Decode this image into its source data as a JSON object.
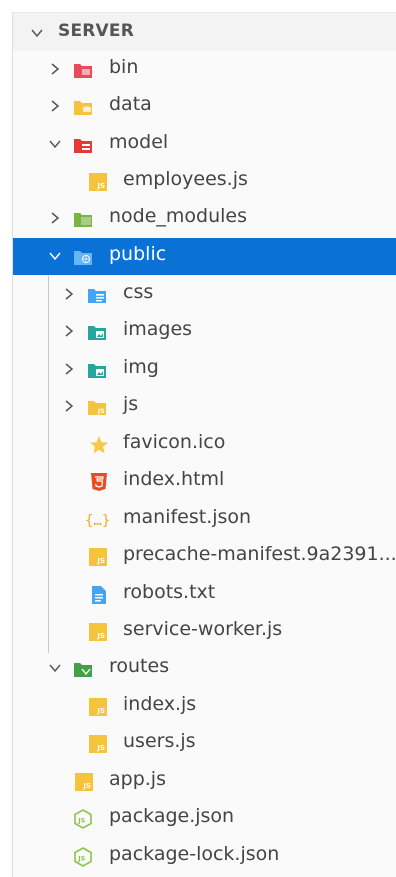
{
  "explorer": {
    "section_title": "SERVER",
    "items": [
      {
        "label": "bin",
        "kind": "folder",
        "expanded": false,
        "icon": "bin-folder-icon",
        "color": "#e84c5c"
      },
      {
        "label": "data",
        "kind": "folder",
        "expanded": false,
        "icon": "data-folder-icon",
        "color": "#f5c33c"
      },
      {
        "label": "model",
        "kind": "folder",
        "expanded": true,
        "icon": "model-folder-icon",
        "color": "#e53935"
      },
      {
        "label": "employees.js",
        "kind": "file",
        "icon": "javascript-file-icon",
        "color": "#f5c33c"
      },
      {
        "label": "node_modules",
        "kind": "folder",
        "expanded": false,
        "icon": "node-modules-folder-icon",
        "color": "#7cb342"
      },
      {
        "label": "public",
        "kind": "folder",
        "expanded": true,
        "selected": true,
        "icon": "public-folder-icon",
        "color": "#42a5f5"
      },
      {
        "label": "css",
        "kind": "folder",
        "expanded": false,
        "icon": "css-folder-icon",
        "color": "#42a5f5"
      },
      {
        "label": "images",
        "kind": "folder",
        "expanded": false,
        "icon": "images-folder-icon",
        "color": "#26a69a"
      },
      {
        "label": "img",
        "kind": "folder",
        "expanded": false,
        "icon": "img-folder-icon",
        "color": "#26a69a"
      },
      {
        "label": "js",
        "kind": "folder",
        "expanded": false,
        "icon": "js-folder-icon",
        "color": "#f5c33c"
      },
      {
        "label": "favicon.ico",
        "kind": "file",
        "icon": "star-icon",
        "color": "#f7c948"
      },
      {
        "label": "index.html",
        "kind": "file",
        "icon": "html5-icon",
        "color": "#e44d26"
      },
      {
        "label": "manifest.json",
        "kind": "file",
        "icon": "json-braces-icon",
        "color": "#f5a623"
      },
      {
        "label": "precache-manifest.9a2391...",
        "kind": "file",
        "icon": "javascript-file-icon",
        "color": "#f5c33c"
      },
      {
        "label": "robots.txt",
        "kind": "file",
        "icon": "text-file-icon",
        "color": "#42a5f5"
      },
      {
        "label": "service-worker.js",
        "kind": "file",
        "icon": "javascript-file-icon",
        "color": "#f5c33c"
      },
      {
        "label": "routes",
        "kind": "folder",
        "expanded": true,
        "icon": "routes-folder-icon",
        "color": "#43a047"
      },
      {
        "label": "index.js",
        "kind": "file",
        "icon": "javascript-file-icon",
        "color": "#f5c33c"
      },
      {
        "label": "users.js",
        "kind": "file",
        "icon": "javascript-file-icon",
        "color": "#f5c33c"
      },
      {
        "label": "app.js",
        "kind": "file",
        "icon": "javascript-file-icon",
        "color": "#f5c33c"
      },
      {
        "label": "package.json",
        "kind": "file",
        "icon": "nodejs-icon",
        "color": "#8bc34a"
      },
      {
        "label": "package-lock.json",
        "kind": "file",
        "icon": "nodejs-icon",
        "color": "#8bc34a"
      }
    ]
  },
  "colors": {
    "selection": "#0a72d6",
    "header_bg": "#f3f3f3",
    "text": "#444444"
  }
}
